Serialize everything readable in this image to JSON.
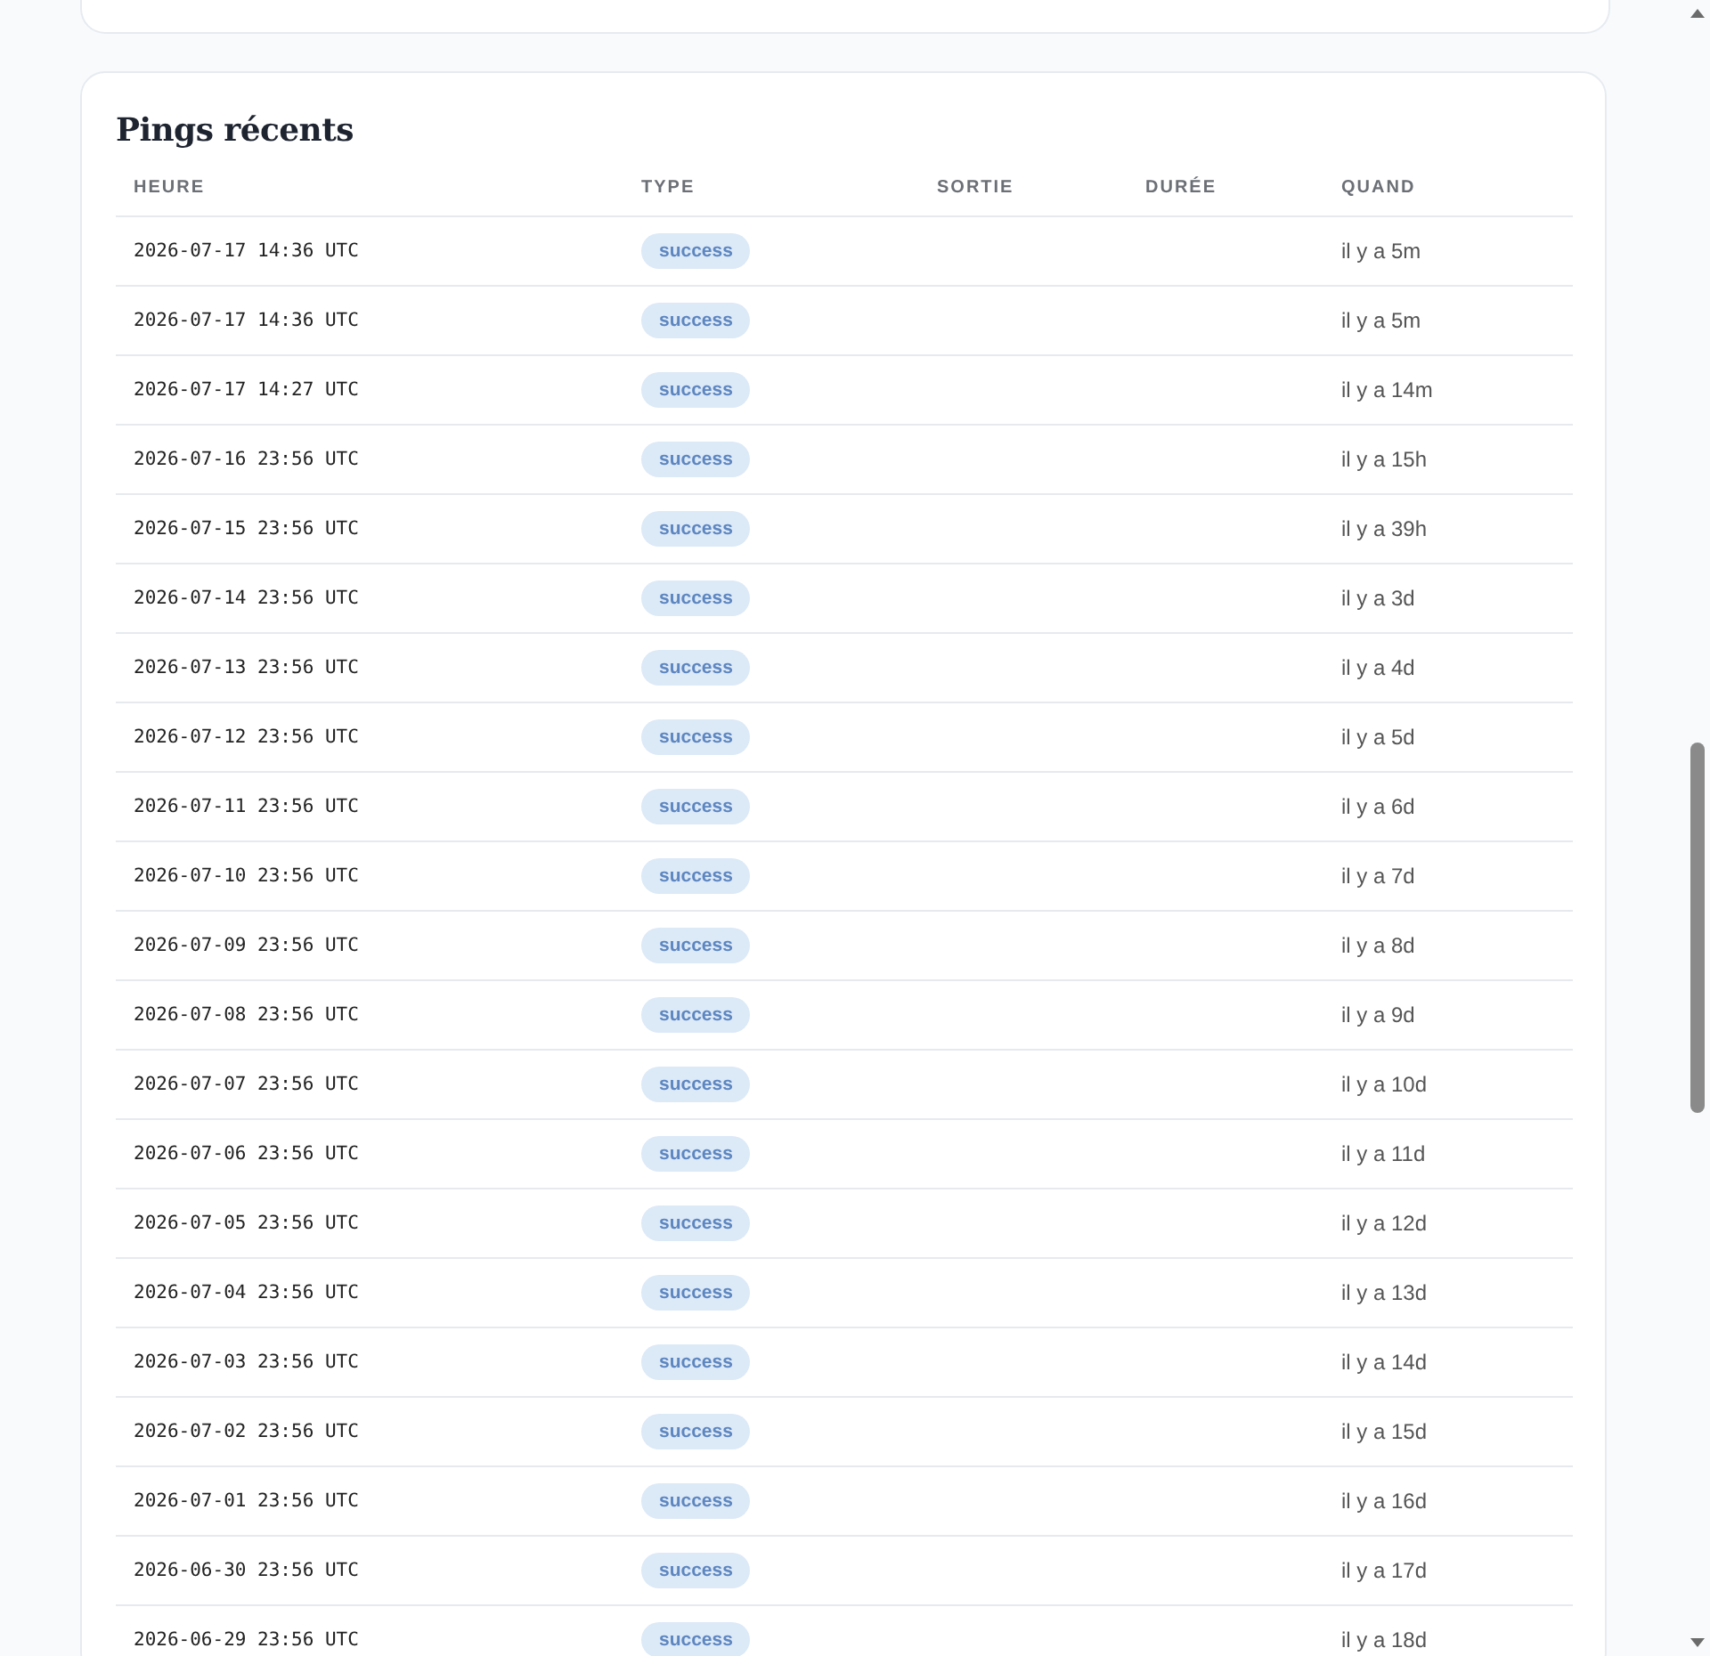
{
  "title": "Pings récents",
  "columns": [
    "HEURE",
    "TYPE",
    "SORTIE",
    "DURÉE",
    "QUAND"
  ],
  "rows": [
    {
      "time": "2026-07-17 14:36 UTC",
      "type": "success",
      "when": "il y a 5m"
    },
    {
      "time": "2026-07-17 14:36 UTC",
      "type": "success",
      "when": "il y a 5m"
    },
    {
      "time": "2026-07-17 14:27 UTC",
      "type": "success",
      "when": "il y a 14m"
    },
    {
      "time": "2026-07-16 23:56 UTC",
      "type": "success",
      "when": "il y a 15h"
    },
    {
      "time": "2026-07-15 23:56 UTC",
      "type": "success",
      "when": "il y a 39h"
    },
    {
      "time": "2026-07-14 23:56 UTC",
      "type": "success",
      "when": "il y a 3d"
    },
    {
      "time": "2026-07-13 23:56 UTC",
      "type": "success",
      "when": "il y a 4d"
    },
    {
      "time": "2026-07-12 23:56 UTC",
      "type": "success",
      "when": "il y a 5d"
    },
    {
      "time": "2026-07-11 23:56 UTC",
      "type": "success",
      "when": "il y a 6d"
    },
    {
      "time": "2026-07-10 23:56 UTC",
      "type": "success",
      "when": "il y a 7d"
    },
    {
      "time": "2026-07-09 23:56 UTC",
      "type": "success",
      "when": "il y a 8d"
    },
    {
      "time": "2026-07-08 23:56 UTC",
      "type": "success",
      "when": "il y a 9d"
    },
    {
      "time": "2026-07-07 23:56 UTC",
      "type": "success",
      "when": "il y a 10d"
    },
    {
      "time": "2026-07-06 23:56 UTC",
      "type": "success",
      "when": "il y a 11d"
    },
    {
      "time": "2026-07-05 23:56 UTC",
      "type": "success",
      "when": "il y a 12d"
    },
    {
      "time": "2026-07-04 23:56 UTC",
      "type": "success",
      "when": "il y a 13d"
    },
    {
      "time": "2026-07-03 23:56 UTC",
      "type": "success",
      "when": "il y a 14d"
    },
    {
      "time": "2026-07-02 23:56 UTC",
      "type": "success",
      "when": "il y a 15d"
    },
    {
      "time": "2026-07-01 23:56 UTC",
      "type": "success",
      "when": "il y a 16d"
    },
    {
      "time": "2026-06-30 23:56 UTC",
      "type": "success",
      "when": "il y a 17d"
    },
    {
      "time": "2026-06-29 23:56 UTC",
      "type": "success",
      "when": "il y a 18d"
    }
  ]
}
